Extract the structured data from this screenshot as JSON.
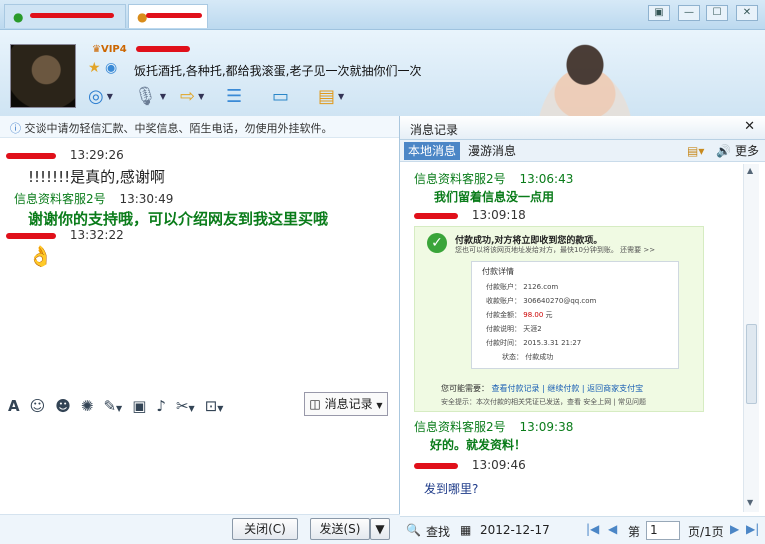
{
  "tabs": [
    {
      "label": "",
      "active": false
    },
    {
      "label": "",
      "active": true
    }
  ],
  "window_controls": {
    "skin": "▣",
    "min": "—",
    "max": "☐",
    "close": "✕"
  },
  "header": {
    "vip_badge": "VIP4",
    "signature": "饭托酒托,各种托,都给我滚蛋,老子见一次就抽你们一次"
  },
  "notice": "交谈中请勿轻信汇款、中奖信息、陌生电话，勿使用外挂软件。",
  "left_messages": [
    {
      "name": "",
      "time": "13:29:26",
      "text": "!!!!!!!是真的,感谢啊"
    },
    {
      "name": "信息资料客服2号",
      "time": "13:30:49",
      "text": "谢谢你的支持哦，可以介绍网友到我这里买哦"
    },
    {
      "name": "",
      "time": "13:32:22",
      "emoji": "👌"
    }
  ],
  "input_toolbar": {
    "msglog_label": "消息记录"
  },
  "buttons": {
    "close": "关闭(C)",
    "send": "发送(S)"
  },
  "history": {
    "title": "消息记录",
    "tab_local": "本地消息",
    "tab_roam": "漫游消息",
    "more": "更多",
    "messages": [
      {
        "name": "信息资料客服2号",
        "time": "13:06:43",
        "text": "我们留着信息没一点用"
      },
      {
        "name": "",
        "time": "13:09:18"
      },
      {
        "name": "信息资料客服2号",
        "time": "13:09:38",
        "text": "好的。就发资料！"
      },
      {
        "name": "",
        "time": "13:09:46",
        "text": "发到哪里?"
      }
    ],
    "payment": {
      "title": "付款成功,对方将立即收到您的款项。",
      "subtitle": "您也可以将该网页地址发给对方，最快10分钟到账。 还需要 >>",
      "detail_header": "付款详情",
      "rows": [
        {
          "label": "付款账户：",
          "value": "2126.com"
        },
        {
          "label": "收款账户：",
          "value": "306640270@qq.com"
        },
        {
          "label": "付款金额：",
          "value": "98.00",
          "unit": "元"
        },
        {
          "label": "付款说明：",
          "value": "天涯2"
        },
        {
          "label": "付款时间：",
          "value": "2015.3.31   21:27"
        },
        {
          "label": "状态：",
          "value": "付款成功"
        }
      ],
      "links_label": "您可能需要：",
      "links": [
        "查看付款记录",
        "继续付款",
        "返回商家支付宝"
      ],
      "footer": "安全提示：本次付款的相关凭证已发送，查看  安全上网 | 常见问题"
    },
    "footer": {
      "search": "查找",
      "date": "2012-12-17",
      "page_label": "第",
      "page_value": "1",
      "page_suffix": "页/1页"
    }
  }
}
